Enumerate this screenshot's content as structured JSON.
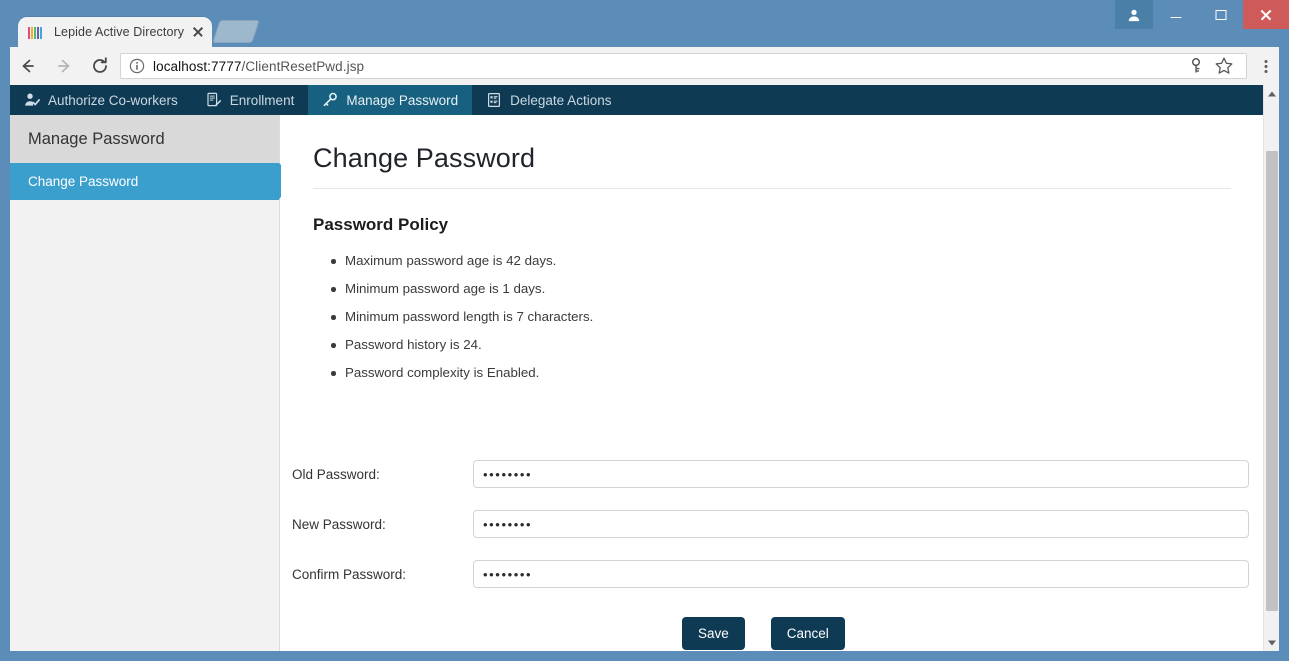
{
  "browser": {
    "tab": {
      "title": "Lepide Active Directory",
      "title_truncated_suffix": "S",
      "favicon": "lepide-logo-icon",
      "close_icon": "close-icon",
      "newtab_icon": "new-tab-button"
    },
    "window_controls": {
      "user_icon": "user-profile-icon",
      "minimize_icon": "minimize-icon",
      "maximize_icon": "maximize-icon",
      "close_icon": "window-close-icon"
    },
    "toolbar": {
      "back_icon": "back-arrow-icon",
      "forward_icon": "forward-arrow-icon",
      "reload_icon": "reload-icon",
      "info_icon": "page-info-icon",
      "url_host": "localhost:7777",
      "url_path": "/ClientResetPwd.jsp",
      "url_full": "localhost:7777/ClientResetPwd.jsp",
      "save_password_icon": "key-icon",
      "bookmark_icon": "star-icon",
      "menu_icon": "three-dot-menu-icon"
    },
    "scrollbar": {
      "up_icon": "scroll-up-arrow-icon",
      "down_icon": "scroll-down-arrow-icon"
    }
  },
  "app": {
    "nav": [
      {
        "label": "Authorize Co-workers",
        "icon": "user-check-icon",
        "active": false
      },
      {
        "label": "Enrollment",
        "icon": "document-pen-icon",
        "active": false
      },
      {
        "label": "Manage Password",
        "icon": "key-icon",
        "active": true
      },
      {
        "label": "Delegate Actions",
        "icon": "document-list-icon",
        "active": false
      }
    ],
    "sidebar": {
      "header": "Manage Password",
      "items": [
        {
          "label": "Change Password",
          "selected": true
        }
      ]
    },
    "content": {
      "page_title": "Change Password",
      "policy_title": "Password Policy",
      "policy_items": [
        "Maximum password age is 42 days.",
        "Minimum password age is 1 days.",
        "Minimum password length is 7 characters.",
        "Password history is 24.",
        "Password complexity is Enabled."
      ],
      "fields": [
        {
          "label": "Old Password:",
          "value": "••••••••",
          "type": "password"
        },
        {
          "label": "New Password:",
          "value": "••••••••",
          "type": "password"
        },
        {
          "label": "Confirm Password:",
          "value": "••••••••",
          "type": "password"
        }
      ],
      "buttons": {
        "save": "Save",
        "cancel": "Cancel"
      }
    }
  },
  "colors": {
    "window_frame": "#5b8db8",
    "nav_bar": "#0f3a54",
    "nav_active": "#18607f",
    "sidebar_bg": "#f2f2f2",
    "sidebar_header_bg": "#d9d9d9",
    "sidebar_selected": "#3a9fcd",
    "button_bg": "#0f3a54",
    "close_button": "#cf5a5a"
  }
}
